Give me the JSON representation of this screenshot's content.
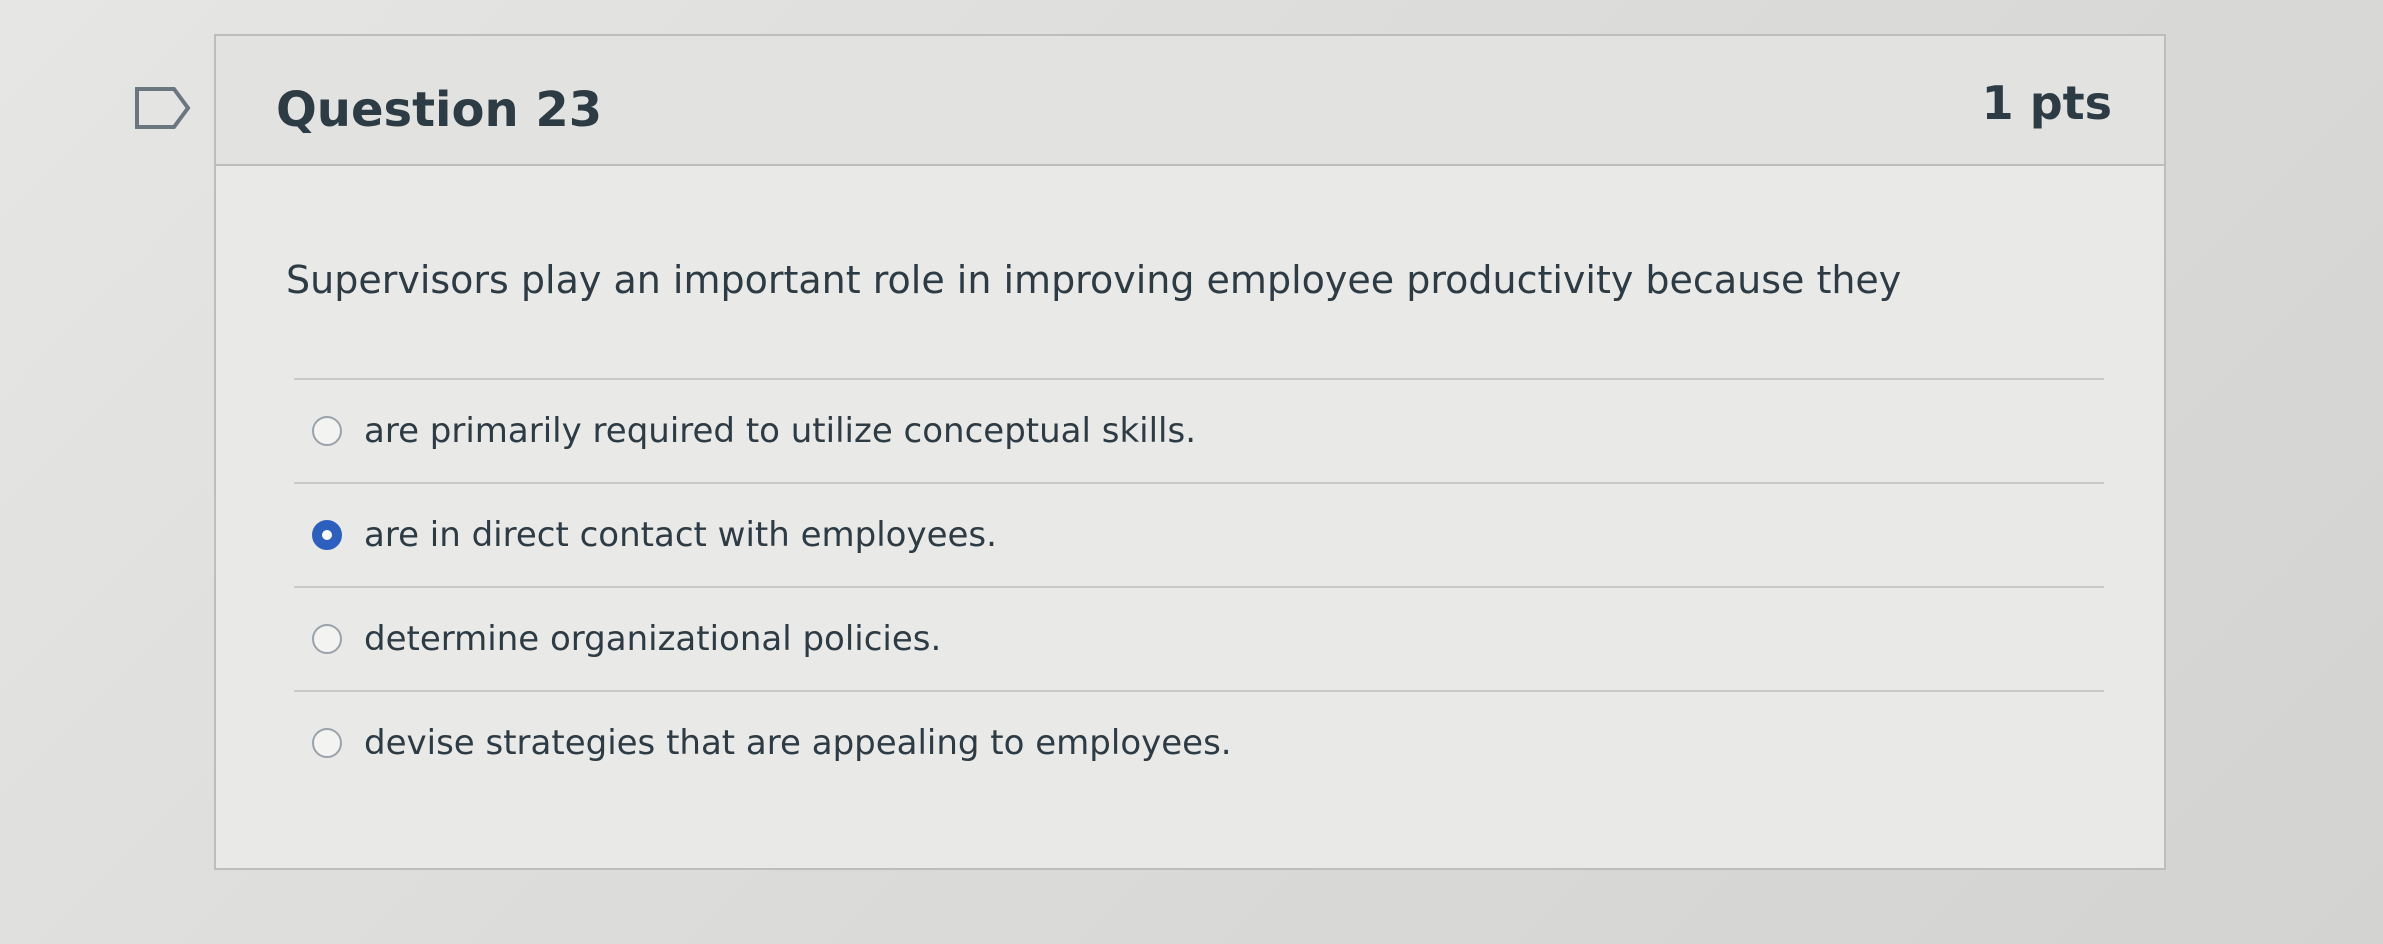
{
  "question": {
    "title": "Question 23",
    "points": "1 pts",
    "prompt": "Supervisors play an important role in improving employee productivity because they",
    "flag_icon": "bookmark-flag-icon",
    "colors": {
      "selected_radio": "#2d5fbf",
      "text": "#2d3b45",
      "border": "#bdbdbb"
    },
    "answers": [
      {
        "label": "are primarily required to utilize conceptual skills.",
        "selected": false
      },
      {
        "label": "are in direct contact with employees.",
        "selected": true
      },
      {
        "label": "determine organizational policies.",
        "selected": false
      },
      {
        "label": "devise strategies that are appealing to employees.",
        "selected": false
      }
    ]
  }
}
